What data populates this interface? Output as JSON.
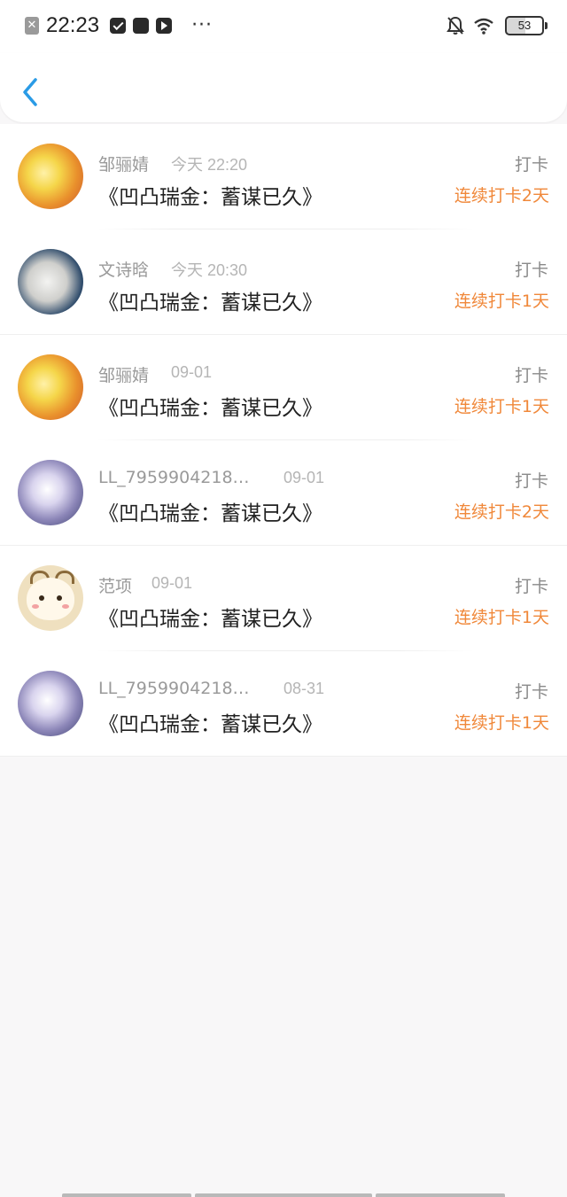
{
  "status_bar": {
    "time": "22:23",
    "battery": "53",
    "icons": [
      "close-notification-icon",
      "mail-app-icon",
      "app-icon",
      "video-app-icon",
      "more-dots-icon",
      "bell-muted-icon",
      "wifi-icon",
      "battery-icon"
    ]
  },
  "nav": {
    "back_icon": "chevron-left-icon",
    "accent_color": "#2a9be6"
  },
  "list": {
    "items": [
      {
        "name": "邹骊婧",
        "time": "今天 22:20",
        "title": "《凹凸瑞金：蓄谋已久》",
        "type": "打卡",
        "streak": "连续打卡2天",
        "avatar": "yellow-anime-avatar"
      },
      {
        "name": "文诗晗",
        "time": "今天 20:30",
        "title": "《凹凸瑞金：蓄谋已久》",
        "type": "打卡",
        "streak": "连续打卡1天",
        "avatar": "boy-photo-avatar"
      },
      {
        "name": "邹骊婧",
        "time": "09-01",
        "title": "《凹凸瑞金：蓄谋已久》",
        "type": "打卡",
        "streak": "连续打卡1天",
        "avatar": "yellow-anime-avatar"
      },
      {
        "name": "LL_7959904218…",
        "time": "09-01",
        "title": "《凹凸瑞金：蓄谋已久》",
        "type": "打卡",
        "streak": "连续打卡2天",
        "avatar": "anime-girl-avatar"
      },
      {
        "name": "范项",
        "time": "09-01",
        "title": "《凹凸瑞金：蓄谋已久》",
        "type": "打卡",
        "streak": "连续打卡1天",
        "avatar": "cartoon-goat-avatar"
      },
      {
        "name": "LL_7959904218…",
        "time": "08-31",
        "title": "《凹凸瑞金：蓄谋已久》",
        "type": "打卡",
        "streak": "连续打卡1天",
        "avatar": "anime-girl-avatar"
      }
    ]
  },
  "colors": {
    "streak": "#f0883a",
    "background": "#f8f7f8"
  }
}
